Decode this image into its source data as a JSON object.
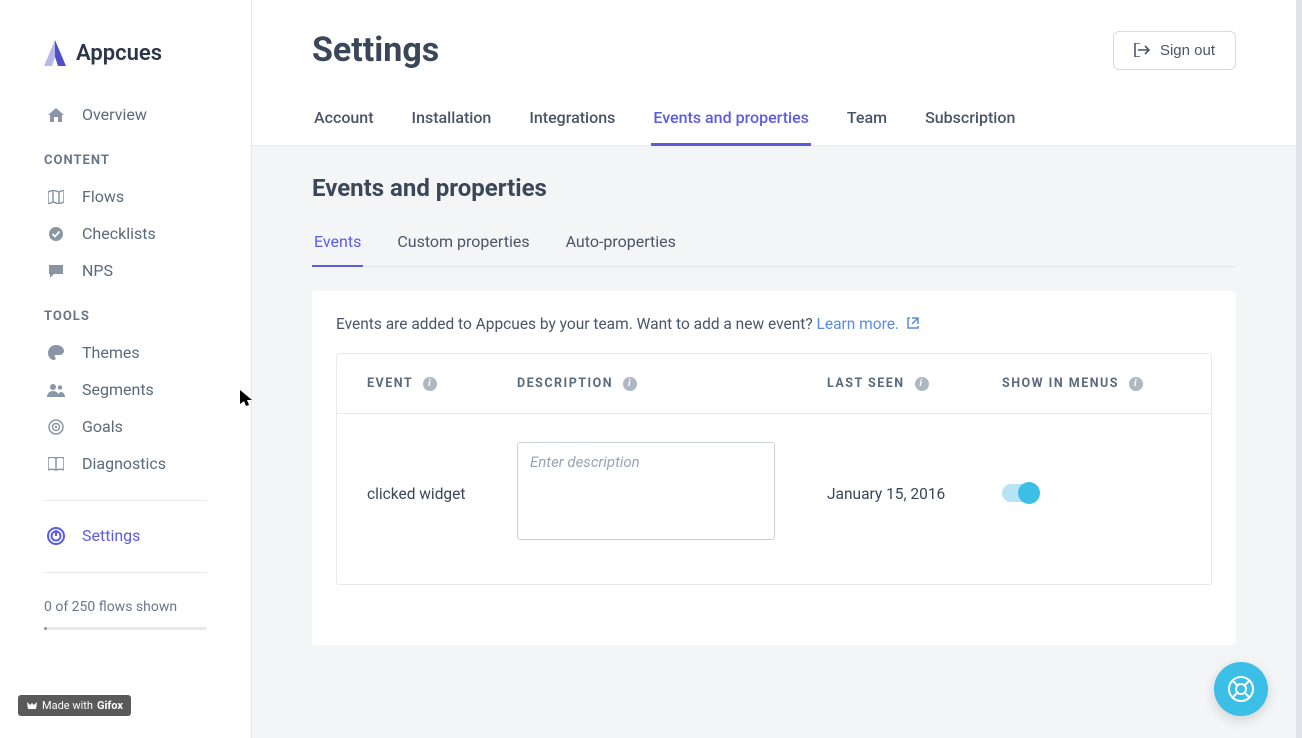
{
  "brand": {
    "name": "Appcues"
  },
  "sidebar": {
    "overview": "Overview",
    "sections": {
      "content": {
        "label": "CONTENT",
        "items": [
          "Flows",
          "Checklists",
          "NPS"
        ]
      },
      "tools": {
        "label": "TOOLS",
        "items": [
          "Themes",
          "Segments",
          "Goals",
          "Diagnostics"
        ]
      }
    },
    "settings": "Settings",
    "flowsShown": "0 of 250 flows shown",
    "madeWithPrefix": "Made with",
    "madeWithBrand": "Gifox"
  },
  "header": {
    "title": "Settings",
    "signOut": "Sign out",
    "tabs": [
      "Account",
      "Installation",
      "Integrations",
      "Events and properties",
      "Team",
      "Subscription"
    ],
    "activeTab": "Events and properties"
  },
  "section": {
    "title": "Events and properties",
    "tabs": [
      "Events",
      "Custom properties",
      "Auto-properties"
    ],
    "activeTab": "Events"
  },
  "card": {
    "intro": "Events are added to Appcues by your team. Want to add a new event? ",
    "learnMore": "Learn more.",
    "columns": {
      "event": "EVENT",
      "description": "DESCRIPTION",
      "lastSeen": "LAST SEEN",
      "showInMenus": "SHOW IN MENUS"
    },
    "row": {
      "event": "clicked widget",
      "descriptionPlaceholder": "Enter description",
      "lastSeen": "January 15, 2016",
      "showInMenus": true
    }
  }
}
